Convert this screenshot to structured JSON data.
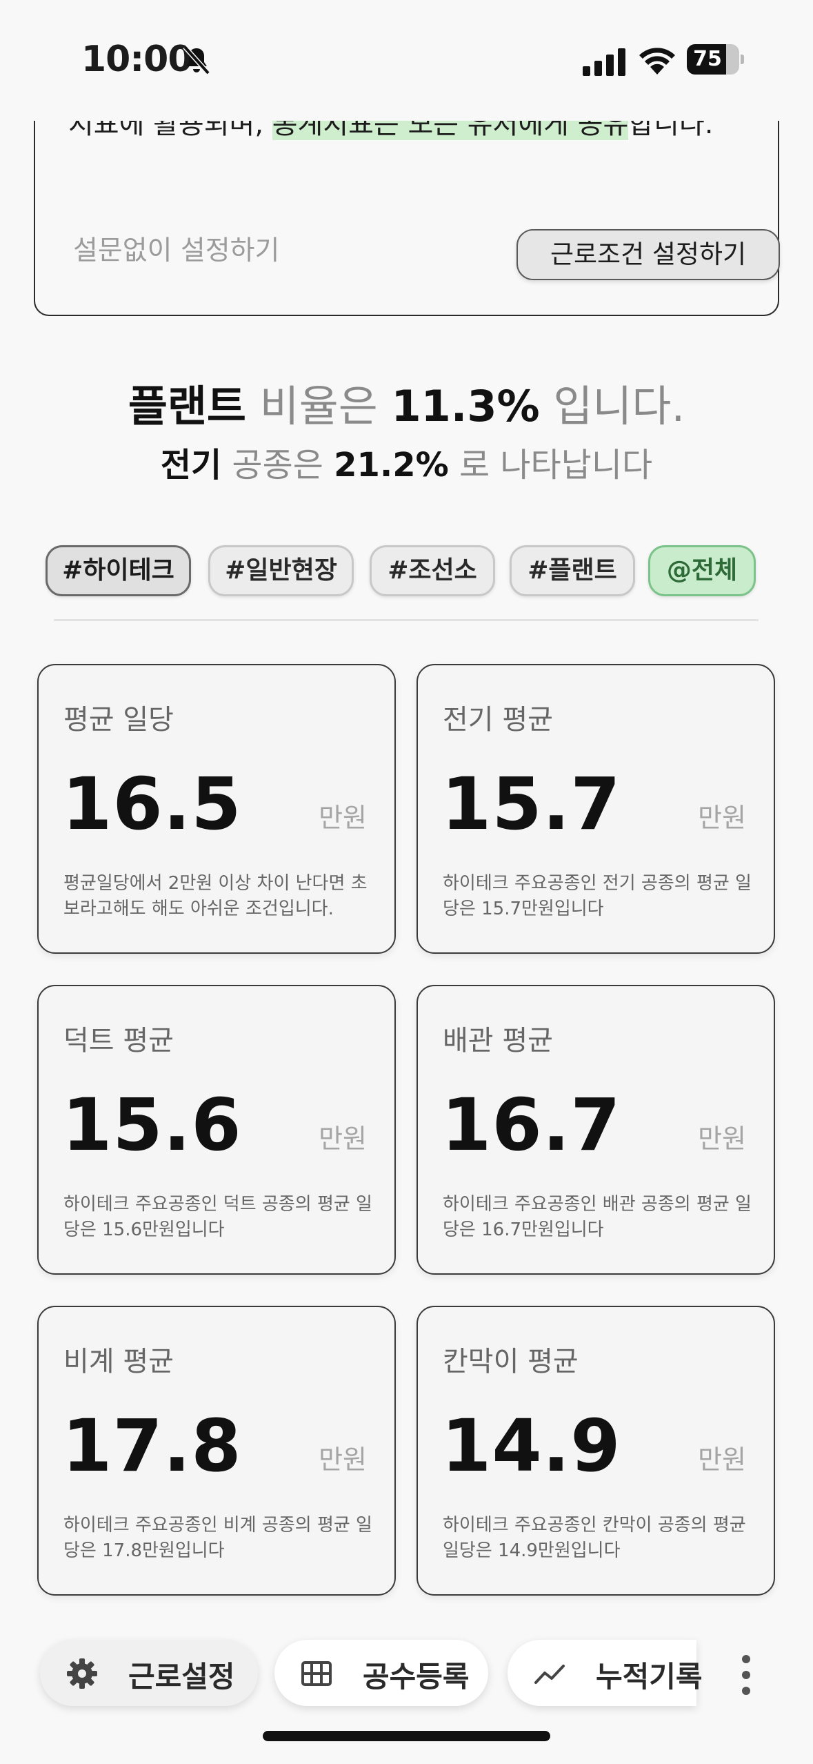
{
  "status_bar": {
    "time": "10:00",
    "battery_level": "75",
    "battery_fraction": 0.75
  },
  "info_card": {
    "text_before": "지표에 활용되며, ",
    "text_highlight": "통계지표는 모든 유저에게 공유",
    "text_after": "합니다.",
    "skip_label": "설문없이 설정하기",
    "setup_button": "근로조건 설정하기"
  },
  "summary": {
    "line1_name": "플랜트",
    "line1_mid": " 비율은 ",
    "line1_value": "11.3%",
    "line1_end": " 입니다.",
    "line2_name": "전기",
    "line2_mid": " 공종은 ",
    "line2_value": "21.2%",
    "line2_end": " 로 나타납니다"
  },
  "tags": [
    {
      "label": "#하이테크"
    },
    {
      "label": "#일반현장"
    },
    {
      "label": "#조선소"
    },
    {
      "label": "#플랜트"
    },
    {
      "label": "@전체"
    }
  ],
  "cards": [
    {
      "title": "평균 일당",
      "value": "16.5",
      "unit": "만원",
      "desc": "평균일당에서 2만원 이상 차이 난다면 초보라고해도 해도 아쉬운 조건입니다."
    },
    {
      "title": "전기 평균",
      "value": "15.7",
      "unit": "만원",
      "desc": "하이테크 주요공종인 전기 공종의 평균 일당은 15.7만원입니다"
    },
    {
      "title": "덕트 평균",
      "value": "15.6",
      "unit": "만원",
      "desc": "하이테크 주요공종인 덕트 공종의 평균 일당은 15.6만원입니다"
    },
    {
      "title": "배관 평균",
      "value": "16.7",
      "unit": "만원",
      "desc": "하이테크 주요공종인 배관 공종의 평균 일당은 16.7만원입니다"
    },
    {
      "title": "비계 평균",
      "value": "17.8",
      "unit": "만원",
      "desc": "하이테크 주요공종인 비계 공종의 평균 일당은 17.8만원입니다"
    },
    {
      "title": "칸막이 평균",
      "value": "14.9",
      "unit": "만원",
      "desc": "하이테크 주요공종인 칸막이 공종의 평균일당은 14.9만원입니다"
    }
  ],
  "bottom_nav": [
    {
      "label": "근로설정",
      "icon": "gear-icon"
    },
    {
      "label": "공수등록",
      "icon": "grid-icon"
    },
    {
      "label": "누적기록",
      "icon": "trend-icon"
    }
  ]
}
